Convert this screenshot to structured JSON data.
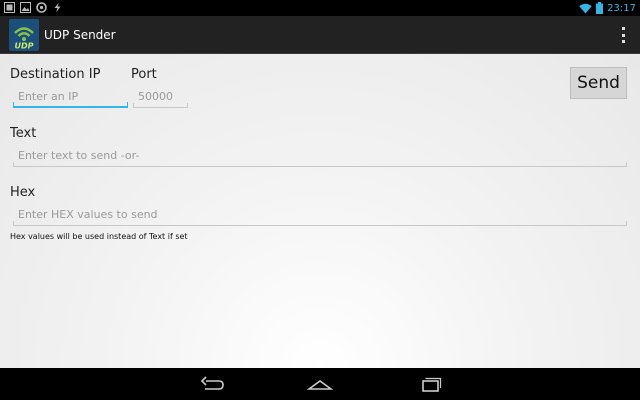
{
  "status_bar": {
    "time": "23:17",
    "icons": [
      "gallery-icon",
      "image-icon",
      "sync-icon",
      "flash-icon",
      "wifi-icon",
      "battery-icon"
    ]
  },
  "action_bar": {
    "app_icon_text": "UDP",
    "title": "UDP Sender",
    "overflow_icon": "overflow-menu-icon"
  },
  "form": {
    "destination_label": "Destination IP",
    "destination_placeholder": "Enter an IP",
    "port_label": "Port",
    "port_placeholder": "50000",
    "send_label": "Send",
    "text_label": "Text",
    "text_placeholder": "Enter text to send -or-",
    "hex_label": "Hex",
    "hex_placeholder": "Enter HEX values to send",
    "hex_hint": "Hex values will be used instead of Text if set"
  },
  "nav_bar": {
    "icons": [
      "back-icon",
      "home-icon",
      "recent-apps-icon"
    ]
  },
  "colors": {
    "accent": "#33b5e5",
    "action_bar": "#222222",
    "app_icon_green": "#8bc34a",
    "app_icon_bg": "#1a4f7a"
  }
}
